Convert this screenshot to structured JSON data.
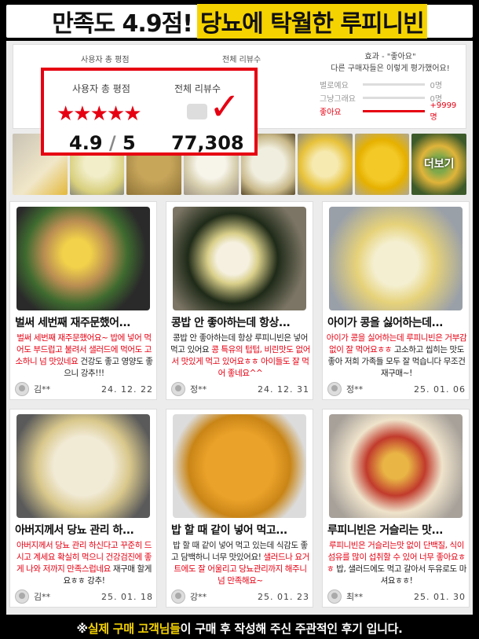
{
  "headline": {
    "part1": "만족도 4.9점!",
    "part2": "당뇨에 탁월한 루피니빈"
  },
  "rating_bg": {
    "avg_label": "사용자 총 평점",
    "total_label": "전체 리뷰수",
    "effect_title": "효과 - \"좋아요\"",
    "effect_sub": "다른 구매자들은 이렇게 평가했어요!",
    "rows": [
      {
        "label": "별로예요",
        "value": "0명",
        "fill": 0
      },
      {
        "label": "그냥그래요",
        "value": "0명",
        "fill": 0
      },
      {
        "label": "좋아요",
        "value": "+9999명",
        "fill": 1
      }
    ]
  },
  "popup": {
    "avg_label": "사용자 총 평점",
    "total_label": "전체 리뷰수",
    "stars": "★★★★★",
    "score": "4.9",
    "score_sep": "/",
    "score_max": "5",
    "total": "77,308",
    "check": "✓"
  },
  "strip": {
    "more_label": "더보기"
  },
  "reviews": [
    {
      "title": "벌써 세번째 재주문했어...",
      "body_red": "벌써 세번째 재주문했어요~ 밥에 넣어 먹어도 부드럽고 불려서 샐러드에 먹어도 고소하니 넘 맛있네요",
      "body_black": " 건강도 좋고 영양도 좋으니 강추!!!",
      "user": "김**",
      "date": "24. 12. 22"
    },
    {
      "title": "콩밥 안 좋아하는데 항상...",
      "body_black": "콩밥 안 좋아하는데 항상 루피니빈은 넣어 먹고 있어요 ",
      "body_red": "콩 특유의 텁텁, 비린맛도 없어서 맛있게 먹고 있어요ㅎㅎ 아이들도 잘 먹어 좋네요^^",
      "user": "정**",
      "date": "24. 12. 31"
    },
    {
      "title": "아이가 콩을 싫어하는데...",
      "body_red": "아이가 콩을 싫어하는데 루피니빈은 거부감 없이 잘 먹어요ㅎㅎ",
      "body_black": " 고소하고 씹히는 맛도 좋아 저희 가족들 모두 잘 먹습니다 무조건 재구매~!",
      "user": "정**",
      "date": "25. 01. 06"
    },
    {
      "title": "아버지께서 당뇨 관리 하...",
      "body_red": "아버지께서 당뇨 관리 하신다고 꾸준히 드시고 계세요 확실히 먹으니 건강검진에 좋게 나와 저까지 만족스럽네요",
      "body_black": " 재구매 할게요ㅎㅎ 강추!",
      "user": "김**",
      "date": "25. 01. 18"
    },
    {
      "title": "밥 할 때 같이 넣어 먹고...",
      "body_black": "밥 할 때 같이 넣어 먹고 있는데 식감도 좋고 담백하니 너무 맛있어요! ",
      "body_red": "샐러드나 요거트에도 잘 어울리고 당뇨관리까지 해주니 넘 만족해요~",
      "user": "강**",
      "date": "25. 01. 23"
    },
    {
      "title": "루피니빈은 거슬리는 맛...",
      "body_red": "루피니빈은 거슬리는맛 없이 단백질, 식이섬유를 많이 섭취할 수 있어 너무 좋아요ㅎㅎ",
      "body_black": " 밥, 샐러드에도 먹고 갈아서 두유로도 마셔요ㅎㅎ!",
      "user": "최**",
      "date": "25. 01. 30"
    }
  ],
  "footer": {
    "prefix": "※ ",
    "highlight": "실제 구매 고객님들",
    "suffix": "이 구매 후 작성해 주신 주관적인 후기 입니다."
  },
  "colors": {
    "accent": "#e60012",
    "highlight": "#f5d300"
  }
}
